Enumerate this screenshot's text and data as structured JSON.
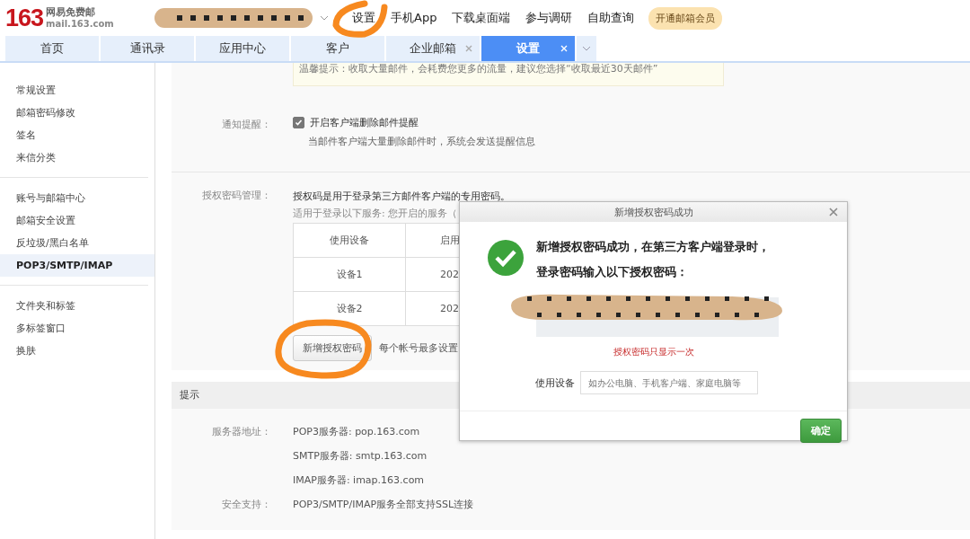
{
  "header": {
    "logo_number": "163",
    "logo_name": "网易免费邮",
    "logo_domain": "mail.163.com",
    "nav": [
      "设置",
      "手机App",
      "下载桌面端",
      "参与调研",
      "自助查询"
    ],
    "vip_button": "开通邮箱会员"
  },
  "tabs": [
    {
      "label": "首页",
      "selected": false,
      "closable": false
    },
    {
      "label": "通讯录",
      "selected": false,
      "closable": false
    },
    {
      "label": "应用中心",
      "selected": false,
      "closable": false
    },
    {
      "label": "客户",
      "selected": false,
      "closable": false
    },
    {
      "label": "企业邮箱",
      "selected": false,
      "closable": true
    },
    {
      "label": "设置",
      "selected": true,
      "closable": true
    }
  ],
  "sidebar": {
    "groups": [
      [
        {
          "label": "常规设置",
          "selected": false
        },
        {
          "label": "邮箱密码修改",
          "selected": false
        },
        {
          "label": "签名",
          "selected": false
        },
        {
          "label": "来信分类",
          "selected": false
        }
      ],
      [
        {
          "label": "账号与邮箱中心",
          "selected": false
        },
        {
          "label": "邮箱安全设置",
          "selected": false
        },
        {
          "label": "反垃圾/黑白名单",
          "selected": false
        },
        {
          "label": "POP3/SMTP/IMAP",
          "selected": true
        }
      ],
      [
        {
          "label": "文件夹和标签",
          "selected": false
        },
        {
          "label": "多标签窗口",
          "selected": false
        },
        {
          "label": "换肤",
          "selected": false
        }
      ]
    ]
  },
  "notice": "温馨提示：收取大量邮件，会耗费您更多的流量，建议您选择“收取最近30天邮件”",
  "notify": {
    "label": "通知提醒：",
    "checkbox": {
      "label": "开启客户端删除邮件提醒",
      "checked": true
    },
    "hint": "当邮件客户端大量删除邮件时，系统会发送提醒信息"
  },
  "auth": {
    "label": "授权密码管理：",
    "desc": "授权码是用于登录第三方邮件客户端的专用密码。",
    "services": "适用于登录以下服务: 您开启的服务（",
    "table": {
      "columns": [
        "使用设备",
        "启用"
      ],
      "rows": [
        [
          "设备1",
          "202"
        ],
        [
          "设备2",
          "202"
        ]
      ]
    },
    "add_button": "新增授权密码",
    "limit_note": "每个帐号最多设置"
  },
  "tips": {
    "title": "提示",
    "rows": [
      {
        "label": "服务器地址：",
        "value": "POP3服务器: pop.163.com"
      },
      {
        "label": "",
        "value": "SMTP服务器: smtp.163.com"
      },
      {
        "label": "",
        "value": "IMAP服务器: imap.163.com"
      },
      {
        "label": "安全支持：",
        "value": "POP3/SMTP/IMAP服务全部支持SSL连接"
      }
    ]
  },
  "dialog": {
    "title": "新增授权密码成功",
    "message": "新增授权密码成功，在第三方客户端登录时，登录密码输入以下授权密码：",
    "warning": "授权密码只显示一次",
    "device_label": "使用设备",
    "device_placeholder": "如办公电脑、手机客户端、家庭电脑等",
    "ok_button": "确定"
  }
}
